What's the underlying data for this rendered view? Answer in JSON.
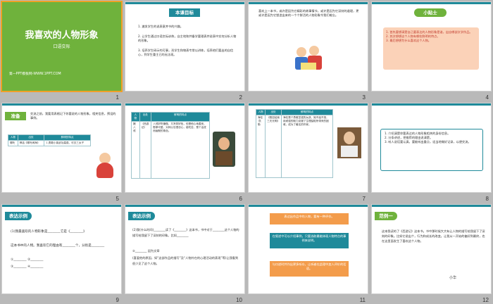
{
  "slides": [
    {
      "num": "1",
      "title": "我喜欢的人物形象",
      "subtitle": "口语交际",
      "footer": "第一PPT模板网-WWW.1PPT.COM"
    },
    {
      "num": "2",
      "header": "本课目标",
      "items": [
        "1. 激发学生的说表意并书的兴趣。",
        "2. 让学生通过口语交际训练，自主地和并备学要理表并说表中实何分析人物的形象。",
        "3. 培养学生研示的可事，形学生和物表专常以讲练，培养他们要出的自信心，到学生重主已的无法现。"
      ]
    },
    {
      "num": "3",
      "text": "喜欢上一本书，或许是因为它精彩的故事情节，或许是因为它深刻的道理，更或许是因为它塑造出来的一个个鲜活的人物形象令我们难忘。"
    },
    {
      "num": "4",
      "header": "小贴士",
      "items": [
        "1. 首先要想清楚自己要表达的人物形象是谁，出自哪部文学作品。",
        "2. 其次想想这个人物有哪些鲜明的特点。",
        "3. 最后想想为什么喜欢这个人物。"
      ]
    },
    {
      "num": "5",
      "tag": "准备",
      "text": "交流之前，我要用表格记下你要说的人物形象，相关信息，预设的事例。",
      "table": {
        "headers": [
          "人物",
          "出处",
          "鲜明的特点"
        ],
        "rows": [
          [
            "哪吒",
            "神话《哪吒闹海》",
            "1.勇敢小孩武功高强，可灭三太子"
          ]
        ]
      }
    },
    {
      "num": "6",
      "table": {
        "headers": [
          "人物",
          "出处",
          "鲜明的特点"
        ],
        "rows": [
          [
            "猪八戒",
            "《西游记》",
            "八戒好吃懒做，又贪财好色，但是他心地善良，憨厚可爱，对师父也很忠心，能吃苦，是个活泼而幽默的角色。"
          ]
        ]
      }
    },
    {
      "num": "7",
      "table": {
        "headers": [
          "人物",
          "出处",
          "鲜明的特点"
        ],
        "rows": [
          [
            "海伦·凯勒",
            "《假如给我三天光明》",
            "海伦是个勇敢坚强的女孩，她不屈不挠，用顽强的毅力克服了生理缺陷所带来的困难，成为了著名的作家。"
          ]
        ]
      }
    },
    {
      "num": "8",
      "items": [
        "1. 介绍清楚你要表达的人物形象相关的身份信息。",
        "2. 分条讲述，把推荐的理由说清楚。",
        "3. 听人说话要认真，要能听出重点，适当地做好记录，以便交流。"
      ]
    },
    {
      "num": "9",
      "tag": "表达示例",
      "lines": [
        "(1)我最喜欢的人物形象是________它是《________》",
        "这本书中的人物。我喜欢它的理由有________个，分别是________",
        "①________ ②________",
        "③________ ④________"
      ]
    },
    {
      "num": "10",
      "tag": "表达示例",
      "lines": [
        "(2)我(什么时间)________读了《________》这本书，书中对于________这个人物的描写给我留下了深刻的印象。比如________",
        "②________ 因为文章",
        "(喜爱他的原因，如“这部作品的描写”及“人物外在的心理活动的表现”等)让我看到很少见了这个人物。"
      ]
    },
    {
      "num": "11",
      "boxes": [
        "表达出作品中的人物，要有一种评价。",
        "在叙述中可以介绍事例，只要选取最能体现人物特点的事例来说明。",
        "与口述时并作出更多听众，让听者在此理中加入评价的话语。"
      ]
    },
    {
      "num": "12",
      "tag": "范例一",
      "text": "这本我读的了《西游记》这本书。书中那时候大大有让人物的描写给我留下了深刻的印象。比如它说出个，行为和成长的改变。让我从一开始的偏好到最终，也在这里面发生了喜欢这个人物。",
      "sign": "小华"
    }
  ],
  "colors": {
    "accent": "#1f8a9a",
    "green": "#6fb23c",
    "orange": "#f39c4b",
    "teal": "#1f8a9a"
  }
}
